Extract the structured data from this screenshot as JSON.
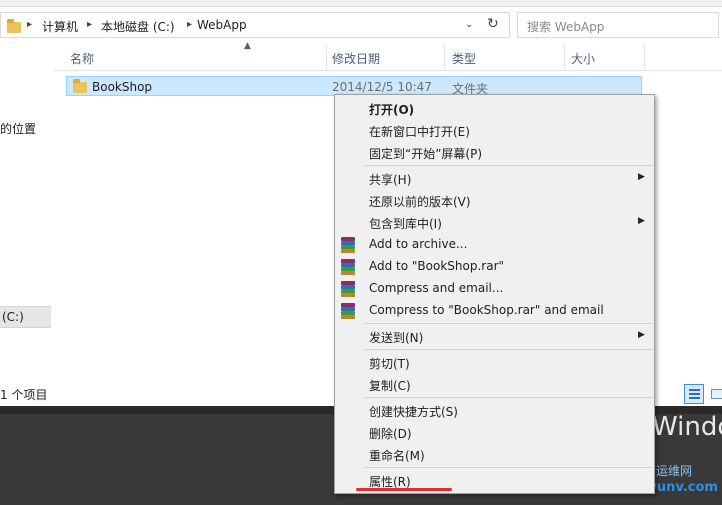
{
  "address": {
    "seg1": "计算机",
    "seg2": "本地磁盘 (C:)",
    "seg3": "WebApp",
    "sep": "▸",
    "dropdown": "⌄",
    "refresh": "↻"
  },
  "search": {
    "placeholder": "搜索 WebApp"
  },
  "nav": {
    "location_item": "的位置",
    "drive_item": "(C:)",
    "status": "1 个项目"
  },
  "columns": {
    "name": "名称",
    "date": "修改日期",
    "type": "类型",
    "size": "大小"
  },
  "file": {
    "name": "BookShop",
    "date": "2014/12/5 10:47",
    "type": "文件夹"
  },
  "desktop": {
    "text": "Windo",
    "watermark_cn": "运维网",
    "watermark_url": "iyunv.com"
  },
  "menu": {
    "open": "打开(O)",
    "open_new_window": "在新窗口中打开(E)",
    "pin_start": "固定到“开始”屏幕(P)",
    "share": "共享(H)",
    "restore": "还原以前的版本(V)",
    "include_library": "包含到库中(I)",
    "add_archive": "Add to archive...",
    "add_rar": "Add to \"BookShop.rar\"",
    "compress_email": "Compress and email...",
    "compress_rar_email": "Compress to \"BookShop.rar\" and email",
    "send_to": "发送到(N)",
    "cut": "剪切(T)",
    "copy": "复制(C)",
    "create_shortcut": "创建快捷方式(S)",
    "delete": "删除(D)",
    "rename": "重命名(M)",
    "properties": "属性(R)"
  },
  "colors": {
    "selection": "#cce8ff",
    "menu_bg": "#f0f0f0",
    "underline": "#e03030"
  }
}
